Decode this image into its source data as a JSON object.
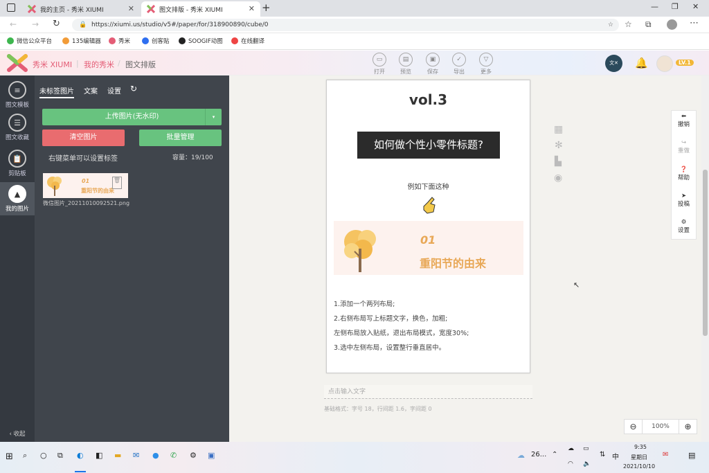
{
  "browser": {
    "tabs": [
      {
        "label": "我的主页 - 秀米 XIUMI",
        "active": false
      },
      {
        "label": "图文排版 - 秀米 XIUMI",
        "active": true
      }
    ],
    "url": "https://xiumi.us/studio/v5#/paper/for/318900890/cube/0",
    "bookmarks": [
      "微信公众平台",
      "135编辑器",
      "秀米",
      "创客贴",
      "SOOGIF动图",
      "在线翻译"
    ]
  },
  "header": {
    "logo_text": "秀米 XIUMI",
    "nav_my": "我的秀米",
    "nav_current": "图文排版",
    "tools": [
      "打开",
      "预览",
      "保存",
      "导出",
      "更多"
    ],
    "badge_level": "LV.1"
  },
  "iconbar": {
    "items": [
      "图文模板",
      "图文收藏",
      "剪贴板",
      "我的图片"
    ],
    "collapse": "收起"
  },
  "panel": {
    "tabs": [
      "未标签图片",
      "文案",
      "设置"
    ],
    "upload_label": "上传图片(无水印)",
    "clear_label": "清空图片",
    "batch_label": "批量管理",
    "hint": "右键菜单可以设置标签",
    "capacity": "容量：19/100",
    "image": {
      "filename": "微信图片_20211010092521.png",
      "num": "01",
      "title": "重阳节的由来"
    }
  },
  "article": {
    "vol": "vol.3",
    "banner": "如何做个性小零件标题?",
    "sub": "例如下面这种",
    "card_num": "01",
    "card_title": "重阳节的由来",
    "steps": [
      "1.添加一个两列布局;",
      "2.右侧布局写上标题文字，换色，加粗;",
      "左侧布局放入贴纸，退出布局模式，宽度30%;",
      "3.选中左侧布局，设置整行垂直居中。"
    ],
    "input_placeholder": "点击输入文字",
    "base_format": "基础格式：字号 18，行间距 1.6，字间距 0",
    "zoom": "100%"
  },
  "right_tools": [
    "撤销",
    "重做",
    "帮助",
    "投稿",
    "设置"
  ],
  "taskbar": {
    "weather": "26...",
    "ime": "中",
    "time": "9:35",
    "weekday": "星期日",
    "date": "2021/10/10"
  },
  "colors": {
    "sidebar": "#343940",
    "panel": "#40454c",
    "green_button": "#68c37f",
    "red_button": "#e96c6f",
    "accent_orange": "#e8a857",
    "banner_bg": "#2b2b2b"
  }
}
